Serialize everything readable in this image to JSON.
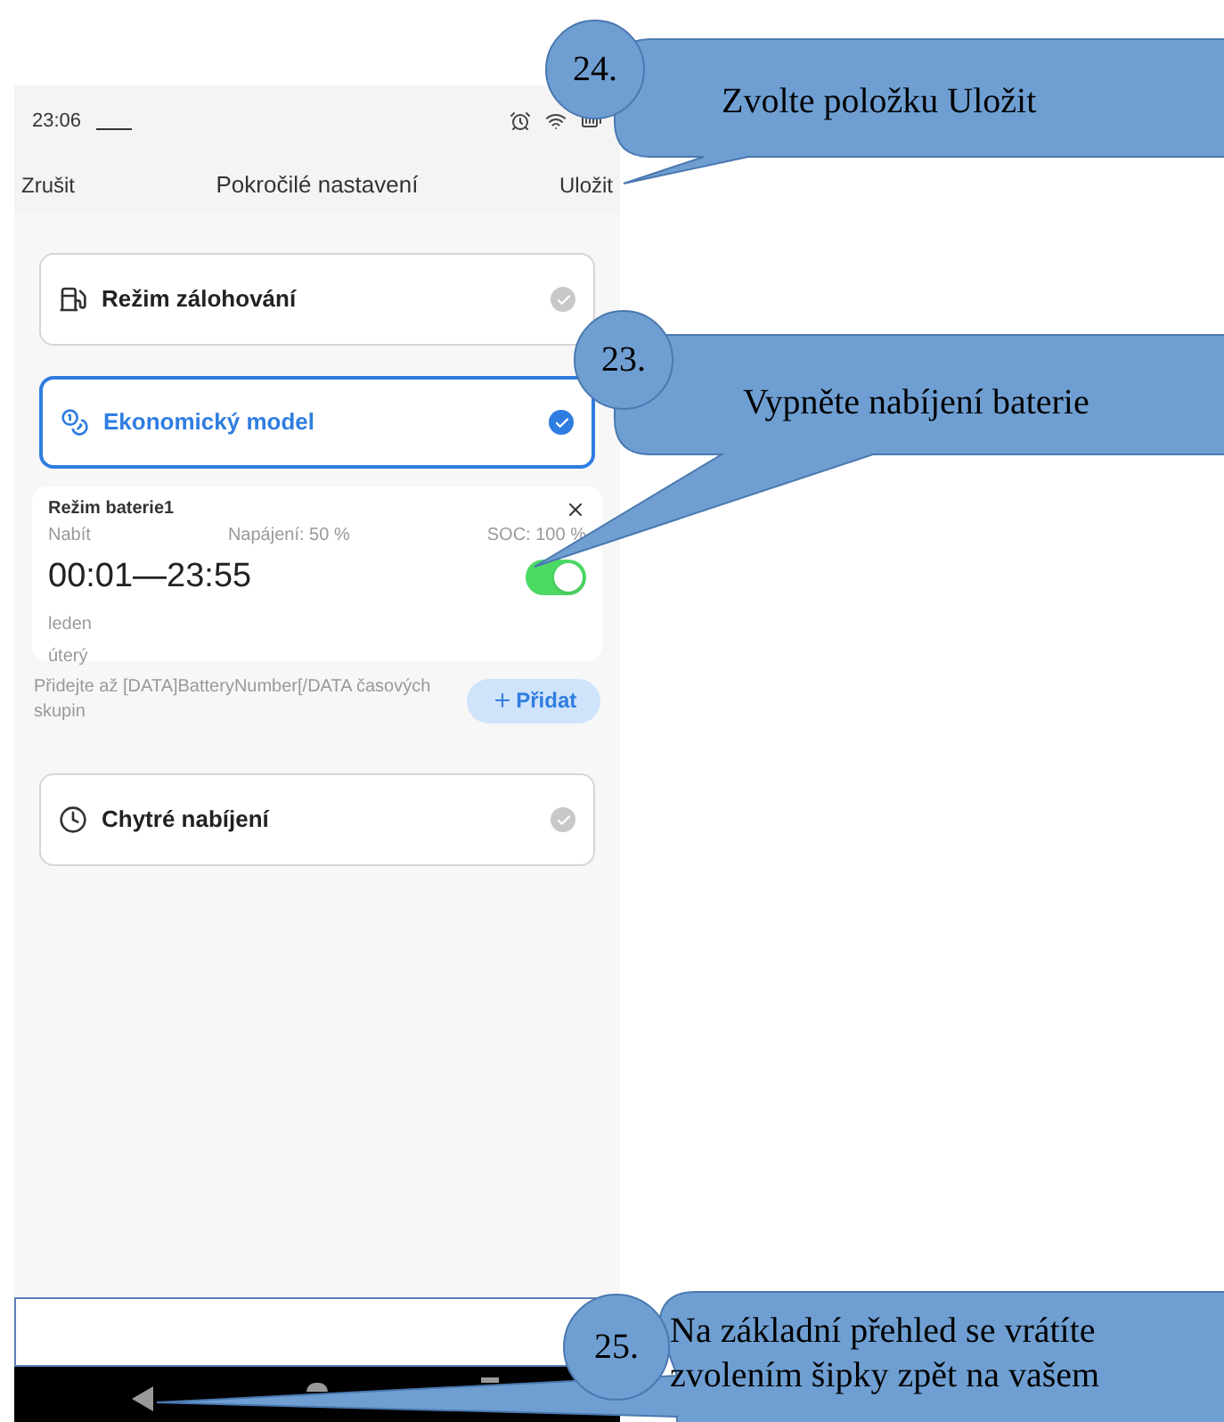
{
  "status_bar": {
    "time": "23:06"
  },
  "header": {
    "cancel": "Zrušit",
    "title": "Pokročilé nastavení",
    "save": "Uložit"
  },
  "modes": [
    {
      "kind": "backup",
      "label": "Režim zálohování",
      "selected": false
    },
    {
      "kind": "economy",
      "label": "Ekonomický model",
      "selected": true
    }
  ],
  "battery_schedule": {
    "title": "Režim baterie1",
    "mode": "Nabít",
    "power": "Napájení: 50 %",
    "soc": "SOC: 100 %",
    "time": "00:01—23:55",
    "on": true,
    "month": "leden",
    "day": "úterý"
  },
  "hint": "Přidejte až [DATA]BatteryNumber[/DATA časových skupin",
  "add_button": "Přidat",
  "smart_mode": {
    "kind": "smart",
    "label": "Chytré nabíjení",
    "selected": false
  },
  "callouts": [
    {
      "number": "24.",
      "text": "Zvolte položku Uložit"
    },
    {
      "number": "23.",
      "text": "Vypněte nabíjení baterie"
    },
    {
      "number": "25.",
      "text": "Na základní přehled se vrátíte zvolením šipky zpět na vašem"
    }
  ]
}
